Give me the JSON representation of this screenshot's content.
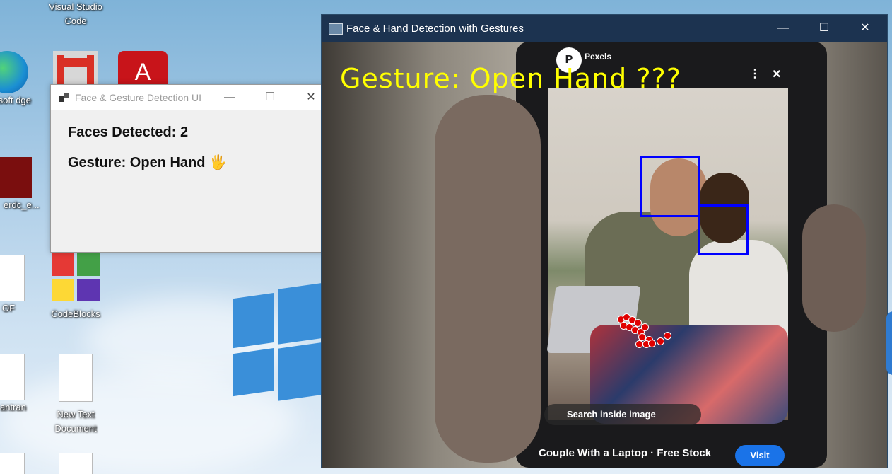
{
  "desktop": {
    "icons": [
      {
        "label": "Visual Studio Code"
      },
      {
        "label": "rosoft dge"
      },
      {
        "label": "erdc_e..."
      },
      {
        "label": "OF"
      },
      {
        "label": "CodeBlocks"
      },
      {
        "label": "antran"
      },
      {
        "label": "New Text Document"
      }
    ]
  },
  "ui_window": {
    "title": "Face & Gesture Detection UI",
    "faces_text": "Faces Detected: 2",
    "gesture_text": "Gesture: Open Hand 🖐"
  },
  "camera_window": {
    "title": "Face & Hand Detection with Gestures",
    "overlay_text": "Gesture: Open Hand ???",
    "phone_source": "Pexels",
    "phone_search": "Search inside image",
    "phone_caption": "Couple With a Laptop · Free Stock",
    "phone_visit": "Visit"
  },
  "colors": {
    "overlay": "#ffff00",
    "face_box": "#0000ff",
    "landmark": "#e00000"
  }
}
